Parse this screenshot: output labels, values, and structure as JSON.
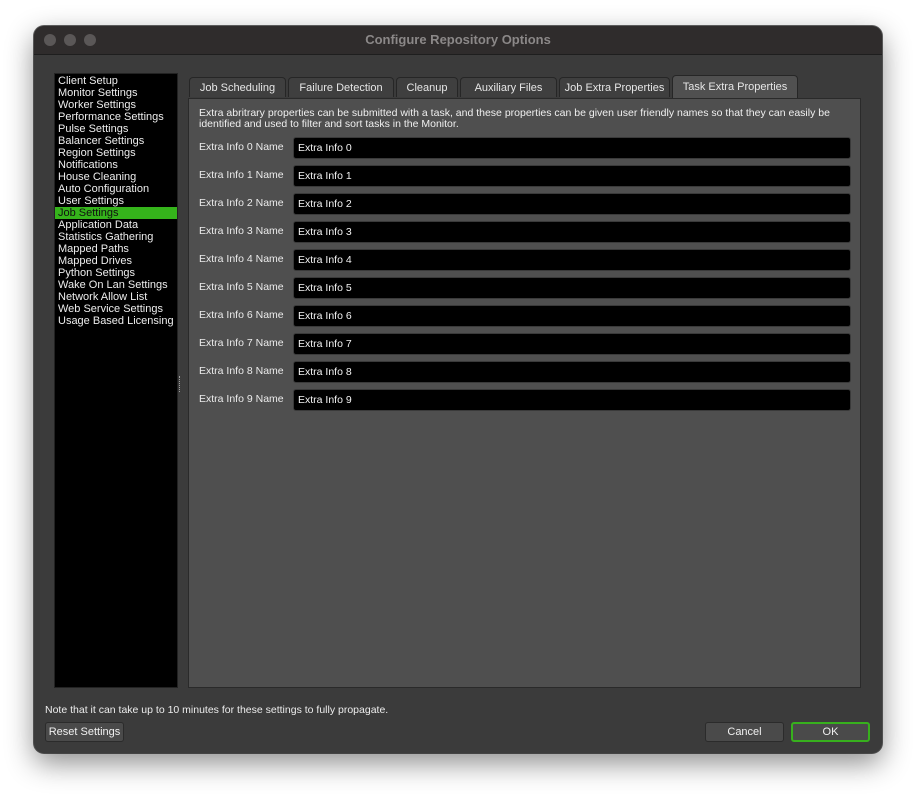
{
  "window": {
    "title": "Configure Repository Options"
  },
  "sidebar": {
    "items": [
      {
        "label": "Client Setup"
      },
      {
        "label": "Monitor Settings"
      },
      {
        "label": "Worker Settings"
      },
      {
        "label": "Performance Settings"
      },
      {
        "label": "Pulse Settings"
      },
      {
        "label": "Balancer Settings"
      },
      {
        "label": "Region Settings"
      },
      {
        "label": "Notifications"
      },
      {
        "label": "House Cleaning"
      },
      {
        "label": "Auto Configuration"
      },
      {
        "label": "User Settings"
      },
      {
        "label": "Job Settings",
        "selected": true
      },
      {
        "label": "Application Data"
      },
      {
        "label": "Statistics Gathering"
      },
      {
        "label": "Mapped Paths"
      },
      {
        "label": "Mapped Drives"
      },
      {
        "label": "Python Settings"
      },
      {
        "label": "Wake On Lan Settings"
      },
      {
        "label": "Network Allow List"
      },
      {
        "label": "Web Service Settings"
      },
      {
        "label": "Usage Based Licensing"
      }
    ]
  },
  "tabs": [
    {
      "label": "Job Scheduling"
    },
    {
      "label": "Failure Detection"
    },
    {
      "label": "Cleanup"
    },
    {
      "label": "Auxiliary Files"
    },
    {
      "label": "Job Extra Properties"
    },
    {
      "label": "Task Extra Properties",
      "active": true
    }
  ],
  "panel": {
    "description": "Extra abritrary properties can be submitted with a task, and these properties can be given user friendly names so that they can easily be identified and used to filter and sort tasks in the Monitor.",
    "rows": [
      {
        "label": "Extra Info 0 Name",
        "value": "Extra Info 0"
      },
      {
        "label": "Extra Info 1 Name",
        "value": "Extra Info 1"
      },
      {
        "label": "Extra Info 2 Name",
        "value": "Extra Info 2"
      },
      {
        "label": "Extra Info 3 Name",
        "value": "Extra Info 3"
      },
      {
        "label": "Extra Info 4 Name",
        "value": "Extra Info 4"
      },
      {
        "label": "Extra Info 5 Name",
        "value": "Extra Info 5"
      },
      {
        "label": "Extra Info 6 Name",
        "value": "Extra Info 6"
      },
      {
        "label": "Extra Info 7 Name",
        "value": "Extra Info 7"
      },
      {
        "label": "Extra Info 8 Name",
        "value": "Extra Info 8"
      },
      {
        "label": "Extra Info 9 Name",
        "value": "Extra Info 9"
      }
    ]
  },
  "footer": {
    "note": "Note that it can take up to 10 minutes for these settings to fully propagate.",
    "reset_label": "Reset Settings",
    "cancel_label": "Cancel",
    "ok_label": "OK"
  },
  "colors": {
    "selection": "#35b41b",
    "ok_border": "#37b01d",
    "window_bg": "#3b3b3b",
    "panel_bg": "#4f4f4f"
  }
}
